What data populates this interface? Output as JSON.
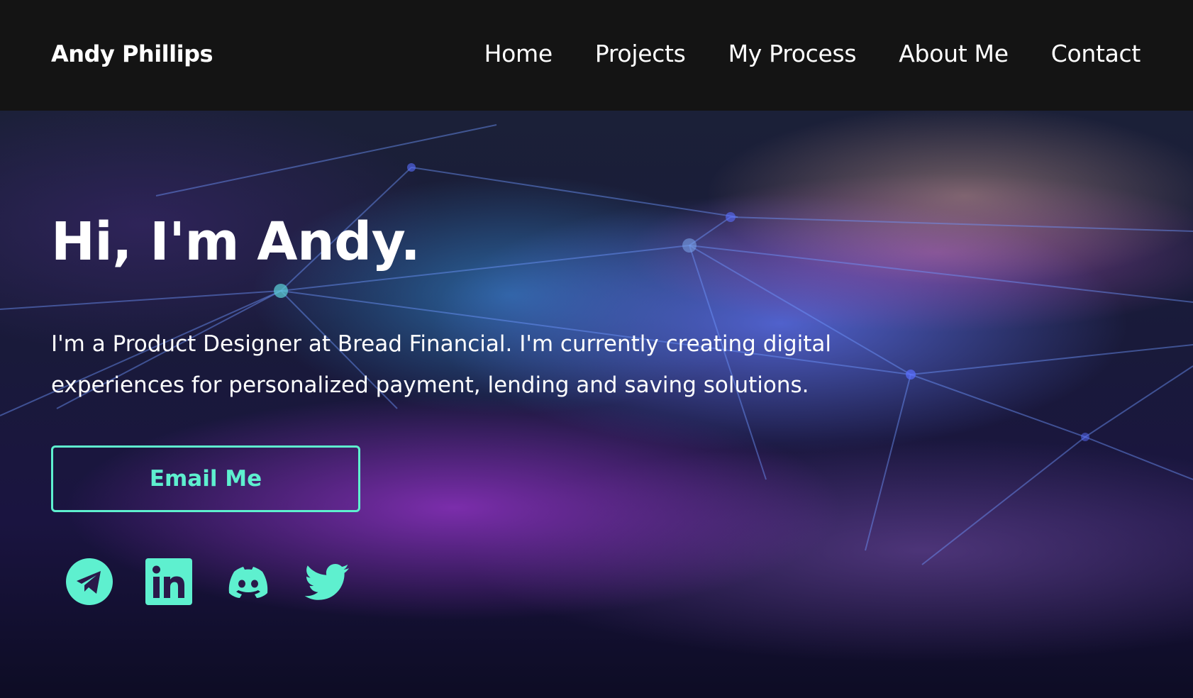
{
  "header": {
    "brand": "Andy Phillips",
    "nav": [
      {
        "label": "Home"
      },
      {
        "label": "Projects"
      },
      {
        "label": "My Process"
      },
      {
        "label": "About Me"
      },
      {
        "label": "Contact"
      }
    ]
  },
  "hero": {
    "title": "Hi, I'm Andy.",
    "description": "I'm a Product Designer at Bread Financial. I'm currently creating digital experiences for personalized payment, lending and saving solutions.",
    "cta_label": "Email Me"
  },
  "socials": [
    {
      "icon": "telegram-icon"
    },
    {
      "icon": "linkedin-icon"
    },
    {
      "icon": "discord-icon"
    },
    {
      "icon": "twitter-icon"
    }
  ],
  "colors": {
    "accent": "#5ef0cf",
    "header_bg": "#141414",
    "text": "#ffffff"
  }
}
